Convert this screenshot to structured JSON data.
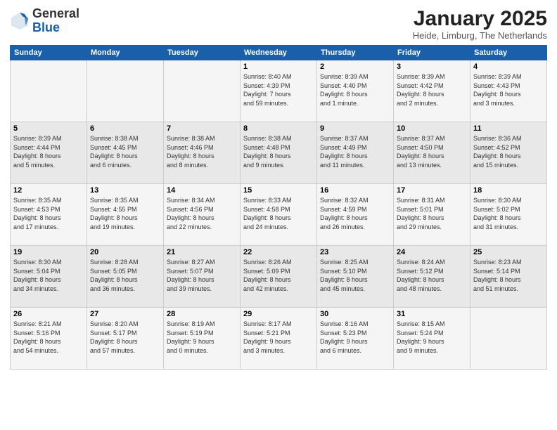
{
  "header": {
    "logo": {
      "general": "General",
      "blue": "Blue"
    },
    "title": "January 2025",
    "location": "Heide, Limburg, The Netherlands"
  },
  "weekdays": [
    "Sunday",
    "Monday",
    "Tuesday",
    "Wednesday",
    "Thursday",
    "Friday",
    "Saturday"
  ],
  "weeks": [
    [
      {
        "day": "",
        "info": ""
      },
      {
        "day": "",
        "info": ""
      },
      {
        "day": "",
        "info": ""
      },
      {
        "day": "1",
        "info": "Sunrise: 8:40 AM\nSunset: 4:39 PM\nDaylight: 7 hours\nand 59 minutes."
      },
      {
        "day": "2",
        "info": "Sunrise: 8:39 AM\nSunset: 4:40 PM\nDaylight: 8 hours\nand 1 minute."
      },
      {
        "day": "3",
        "info": "Sunrise: 8:39 AM\nSunset: 4:42 PM\nDaylight: 8 hours\nand 2 minutes."
      },
      {
        "day": "4",
        "info": "Sunrise: 8:39 AM\nSunset: 4:43 PM\nDaylight: 8 hours\nand 3 minutes."
      }
    ],
    [
      {
        "day": "5",
        "info": "Sunrise: 8:39 AM\nSunset: 4:44 PM\nDaylight: 8 hours\nand 5 minutes."
      },
      {
        "day": "6",
        "info": "Sunrise: 8:38 AM\nSunset: 4:45 PM\nDaylight: 8 hours\nand 6 minutes."
      },
      {
        "day": "7",
        "info": "Sunrise: 8:38 AM\nSunset: 4:46 PM\nDaylight: 8 hours\nand 8 minutes."
      },
      {
        "day": "8",
        "info": "Sunrise: 8:38 AM\nSunset: 4:48 PM\nDaylight: 8 hours\nand 9 minutes."
      },
      {
        "day": "9",
        "info": "Sunrise: 8:37 AM\nSunset: 4:49 PM\nDaylight: 8 hours\nand 11 minutes."
      },
      {
        "day": "10",
        "info": "Sunrise: 8:37 AM\nSunset: 4:50 PM\nDaylight: 8 hours\nand 13 minutes."
      },
      {
        "day": "11",
        "info": "Sunrise: 8:36 AM\nSunset: 4:52 PM\nDaylight: 8 hours\nand 15 minutes."
      }
    ],
    [
      {
        "day": "12",
        "info": "Sunrise: 8:35 AM\nSunset: 4:53 PM\nDaylight: 8 hours\nand 17 minutes."
      },
      {
        "day": "13",
        "info": "Sunrise: 8:35 AM\nSunset: 4:55 PM\nDaylight: 8 hours\nand 19 minutes."
      },
      {
        "day": "14",
        "info": "Sunrise: 8:34 AM\nSunset: 4:56 PM\nDaylight: 8 hours\nand 22 minutes."
      },
      {
        "day": "15",
        "info": "Sunrise: 8:33 AM\nSunset: 4:58 PM\nDaylight: 8 hours\nand 24 minutes."
      },
      {
        "day": "16",
        "info": "Sunrise: 8:32 AM\nSunset: 4:59 PM\nDaylight: 8 hours\nand 26 minutes."
      },
      {
        "day": "17",
        "info": "Sunrise: 8:31 AM\nSunset: 5:01 PM\nDaylight: 8 hours\nand 29 minutes."
      },
      {
        "day": "18",
        "info": "Sunrise: 8:30 AM\nSunset: 5:02 PM\nDaylight: 8 hours\nand 31 minutes."
      }
    ],
    [
      {
        "day": "19",
        "info": "Sunrise: 8:30 AM\nSunset: 5:04 PM\nDaylight: 8 hours\nand 34 minutes."
      },
      {
        "day": "20",
        "info": "Sunrise: 8:28 AM\nSunset: 5:05 PM\nDaylight: 8 hours\nand 36 minutes."
      },
      {
        "day": "21",
        "info": "Sunrise: 8:27 AM\nSunset: 5:07 PM\nDaylight: 8 hours\nand 39 minutes."
      },
      {
        "day": "22",
        "info": "Sunrise: 8:26 AM\nSunset: 5:09 PM\nDaylight: 8 hours\nand 42 minutes."
      },
      {
        "day": "23",
        "info": "Sunrise: 8:25 AM\nSunset: 5:10 PM\nDaylight: 8 hours\nand 45 minutes."
      },
      {
        "day": "24",
        "info": "Sunrise: 8:24 AM\nSunset: 5:12 PM\nDaylight: 8 hours\nand 48 minutes."
      },
      {
        "day": "25",
        "info": "Sunrise: 8:23 AM\nSunset: 5:14 PM\nDaylight: 8 hours\nand 51 minutes."
      }
    ],
    [
      {
        "day": "26",
        "info": "Sunrise: 8:21 AM\nSunset: 5:16 PM\nDaylight: 8 hours\nand 54 minutes."
      },
      {
        "day": "27",
        "info": "Sunrise: 8:20 AM\nSunset: 5:17 PM\nDaylight: 8 hours\nand 57 minutes."
      },
      {
        "day": "28",
        "info": "Sunrise: 8:19 AM\nSunset: 5:19 PM\nDaylight: 9 hours\nand 0 minutes."
      },
      {
        "day": "29",
        "info": "Sunrise: 8:17 AM\nSunset: 5:21 PM\nDaylight: 9 hours\nand 3 minutes."
      },
      {
        "day": "30",
        "info": "Sunrise: 8:16 AM\nSunset: 5:23 PM\nDaylight: 9 hours\nand 6 minutes."
      },
      {
        "day": "31",
        "info": "Sunrise: 8:15 AM\nSunset: 5:24 PM\nDaylight: 9 hours\nand 9 minutes."
      },
      {
        "day": "",
        "info": ""
      }
    ]
  ]
}
